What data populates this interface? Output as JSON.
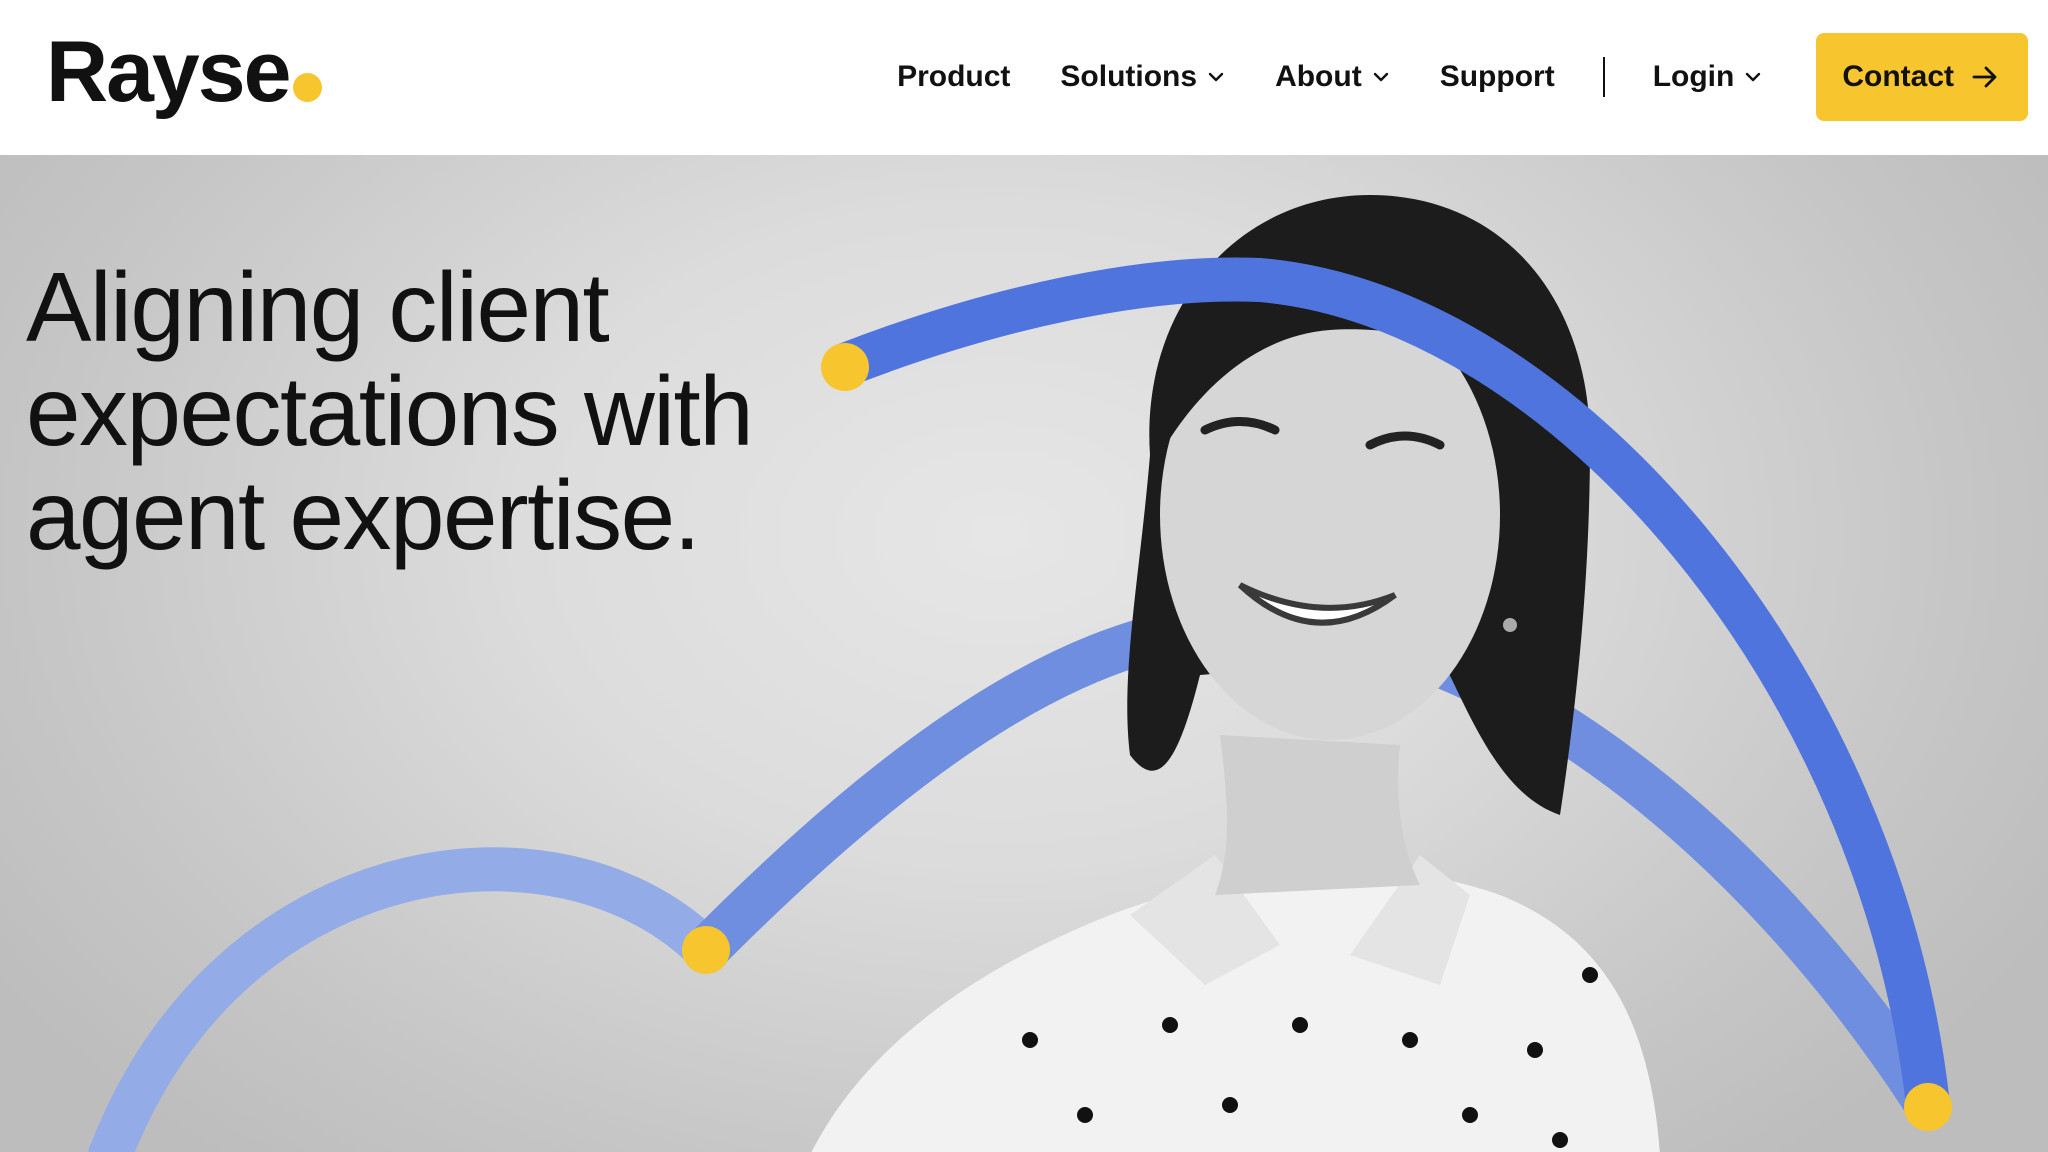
{
  "brand": {
    "name": "Rayse",
    "accent_color": "#f7c52d"
  },
  "nav": {
    "items": [
      {
        "label": "Product",
        "has_dropdown": false
      },
      {
        "label": "Solutions",
        "has_dropdown": true
      },
      {
        "label": "About",
        "has_dropdown": true
      },
      {
        "label": "Support",
        "has_dropdown": false
      }
    ],
    "login_label": "Login",
    "contact_label": "Contact"
  },
  "hero": {
    "headline_lines": [
      "Aligning client",
      "expectations with",
      "agent expertise."
    ],
    "image_subject": "smiling woman in polka-dot shirt",
    "arc_colors": {
      "light": "#93abe6",
      "mid": "#6f8edf",
      "dark": "#4f74dd"
    }
  },
  "icons": {
    "dropdown": "chevron-down-icon",
    "contact_arrow": "arrow-right-icon"
  }
}
